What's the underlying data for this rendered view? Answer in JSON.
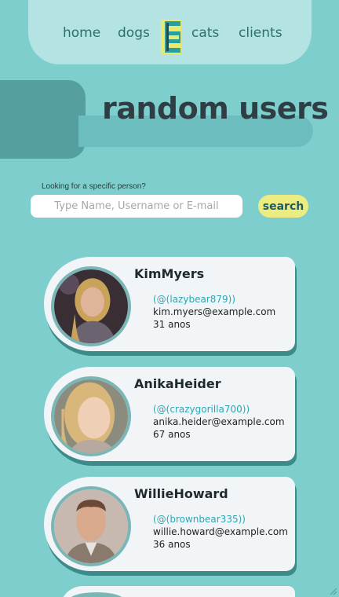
{
  "nav": {
    "links": [
      "home",
      "dogs",
      "cats",
      "clients"
    ],
    "logo_letter": "E"
  },
  "hero": {
    "title": "random users"
  },
  "search": {
    "label": "Looking for a specific person?",
    "placeholder": "Type Name, Username or E-mail",
    "value": "",
    "button_label": "search"
  },
  "users": [
    {
      "name": "KimMyers",
      "username": "(@(lazybear879))",
      "email": "kim.myers@example.com",
      "age": "31 anos"
    },
    {
      "name": "AnikaHeider",
      "username": "(@(crazygorilla700))",
      "email": "anika.heider@example.com",
      "age": "67 anos"
    },
    {
      "name": "WillieHoward",
      "username": "(@(brownbear335))",
      "email": "willie.howard@example.com",
      "age": "36 anos"
    }
  ],
  "colors": {
    "background": "#7ecece",
    "navbar": "#b4e3e3",
    "accent_button": "#ecec80",
    "username_teal": "#2aa7b5",
    "card": "#f1f5f7",
    "title": "#2f3e44"
  }
}
